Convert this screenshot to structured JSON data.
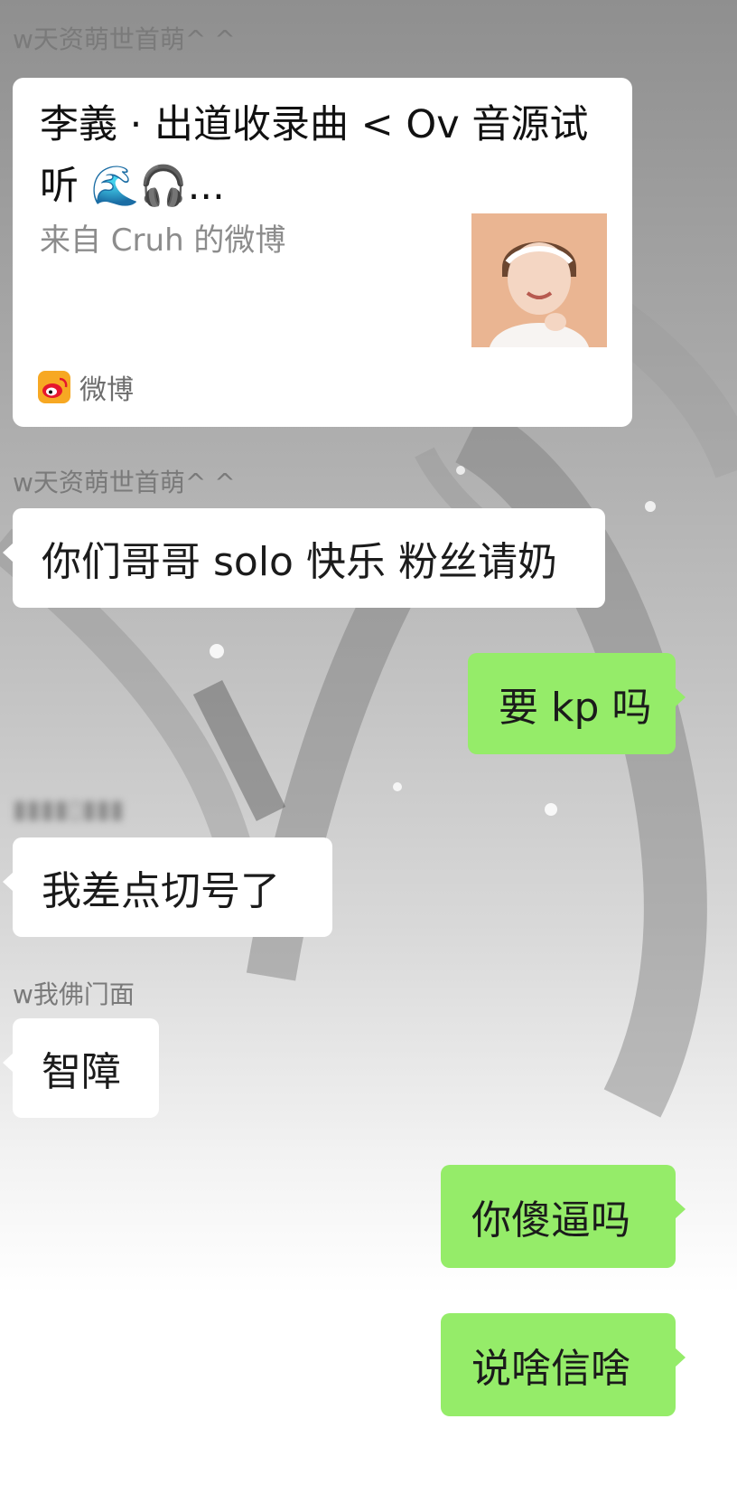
{
  "chat": {
    "messages": [
      {
        "type": "share_card",
        "sender": "w天资萌世首萌^ ^",
        "card": {
          "title": "李義 ·  出道收录曲 < Ov    音源试听 🌊🎧...",
          "source": "来自 Cruh 的微博",
          "thumbnail": "weibo-post-photo",
          "platform_icon": "weibo-icon",
          "platform_label": "微博"
        }
      },
      {
        "type": "text",
        "side": "left",
        "sender": "w天资萌世首萌^ ^",
        "text": "你们哥哥 solo 快乐 粉丝请奶"
      },
      {
        "type": "text",
        "side": "right",
        "text": "要 kp 吗"
      },
      {
        "type": "text",
        "side": "left",
        "sender": "",
        "text": "我差点切号了"
      },
      {
        "type": "text",
        "side": "left",
        "sender": "w我佛门面",
        "text": "智障"
      },
      {
        "type": "text",
        "side": "right",
        "text": "你傻逼吗"
      },
      {
        "type": "text",
        "side": "right",
        "text": "说啥信啥"
      }
    ]
  },
  "colors": {
    "incoming_bubble": "#ffffff",
    "outgoing_bubble": "#95ec69",
    "sender_name": "#7a7a7a"
  }
}
